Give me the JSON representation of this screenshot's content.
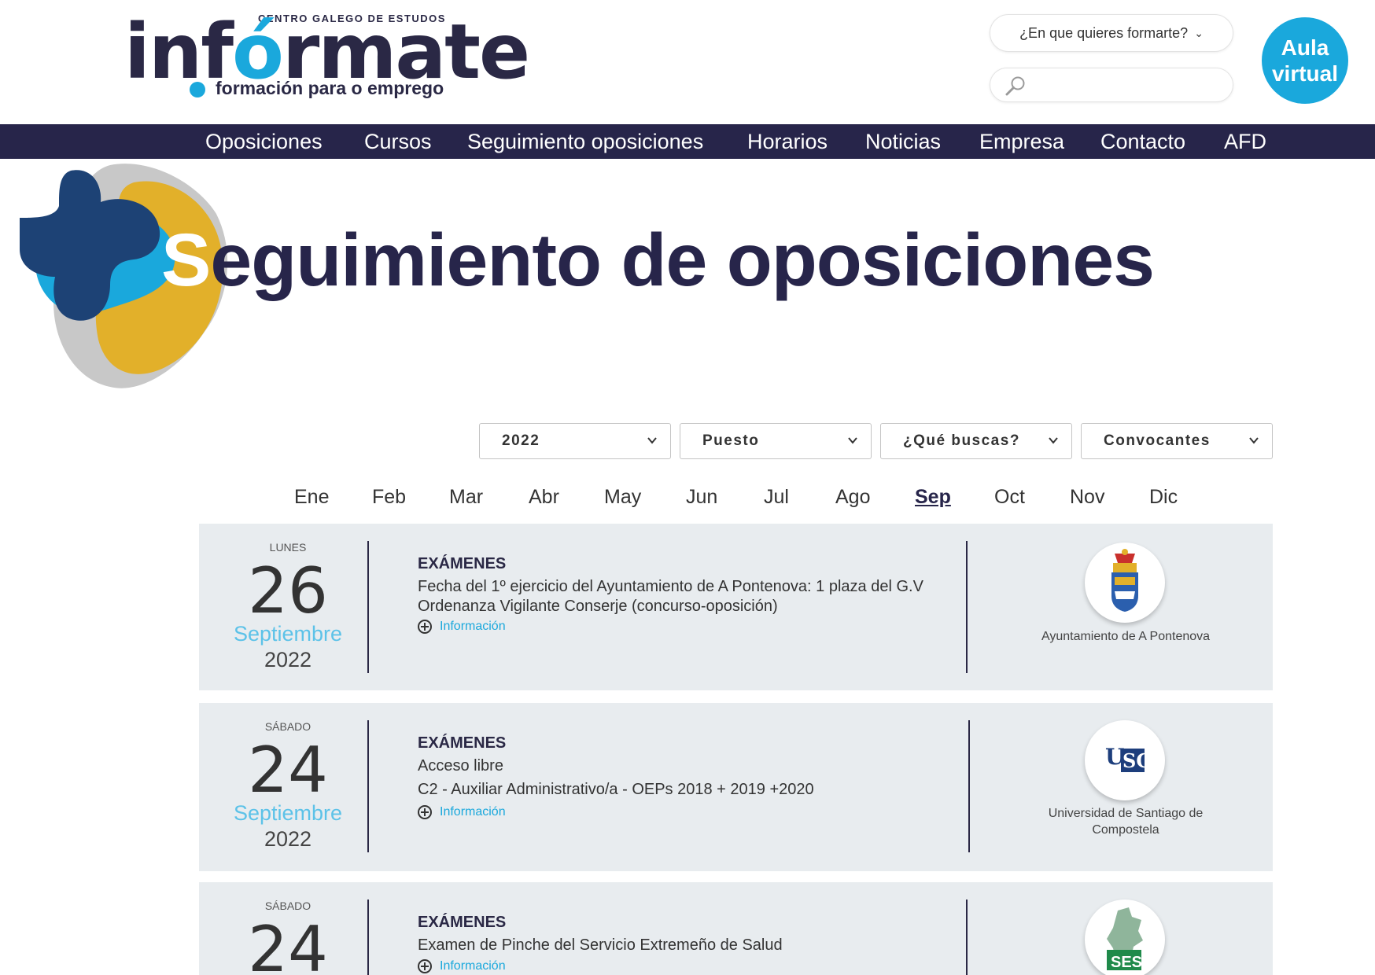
{
  "header": {
    "logo_top": "CENTRO GALEGO DE ESTUDOS",
    "logo_main_a": "inf",
    "logo_main_b": "ó",
    "logo_main_c": "rmate",
    "logo_sub": "formación para o emprego",
    "formarte_select": "¿En que quieres formarte?",
    "search_placeholder": "",
    "aula_line1": "Aula",
    "aula_line2": "virtual"
  },
  "nav": {
    "items": [
      "Oposiciones",
      "Cursos",
      "Seguimiento oposiciones",
      "Horarios",
      "Noticias",
      "Empresa",
      "Contacto",
      "AFD"
    ]
  },
  "hero": {
    "title_first": "S",
    "title_rest": "eguimiento de oposiciones"
  },
  "filters": {
    "year": "2022",
    "puesto": "Puesto",
    "que_buscas": "¿Qué buscas?",
    "convocantes": "Convocantes"
  },
  "months": {
    "items": [
      "Ene",
      "Feb",
      "Mar",
      "Abr",
      "May",
      "Jun",
      "Jul",
      "Ago",
      "Sep",
      "Oct",
      "Nov",
      "Dic"
    ],
    "active": "Sep"
  },
  "events": [
    {
      "day_name": "LUNES",
      "day": "26",
      "month": "Septiembre",
      "year": "2022",
      "category": "EXÁMENES",
      "line1": "Fecha del 1º ejercicio del Ayuntamiento de A Pontenova: 1 plaza del G.V",
      "line2": "Ordenanza Vigilante Conserje (concurso-oposición)",
      "info": "Información",
      "org": "Ayuntamiento de A Pontenova",
      "org_icon": "coat-of-arms-icon"
    },
    {
      "day_name": "SÁBADO",
      "day": "24",
      "month": "Septiembre",
      "year": "2022",
      "category": "EXÁMENES",
      "line1": "Acceso libre",
      "line2": "C2 - Auxiliar Administrativo/a - OEPs 2018 + 2019 +2020",
      "info": "Información",
      "org_line1": "Universidad de Santiago de",
      "org_line2": "Compostela",
      "org_icon": "usc-logo-icon"
    },
    {
      "day_name": "SÁBADO",
      "day": "24",
      "category": "EXÁMENES",
      "line1": "Examen de Pinche del Servicio Extremeño de Salud",
      "info": "Información",
      "org_icon": "ses-logo-icon",
      "org_logo_text": "SES"
    }
  ],
  "colors": {
    "navy": "#27254a",
    "accent_blue": "#1aa8dc",
    "card_bg": "#e8ecef",
    "yellow": "#e2b02a",
    "gray_blob": "#c8c8c8"
  }
}
